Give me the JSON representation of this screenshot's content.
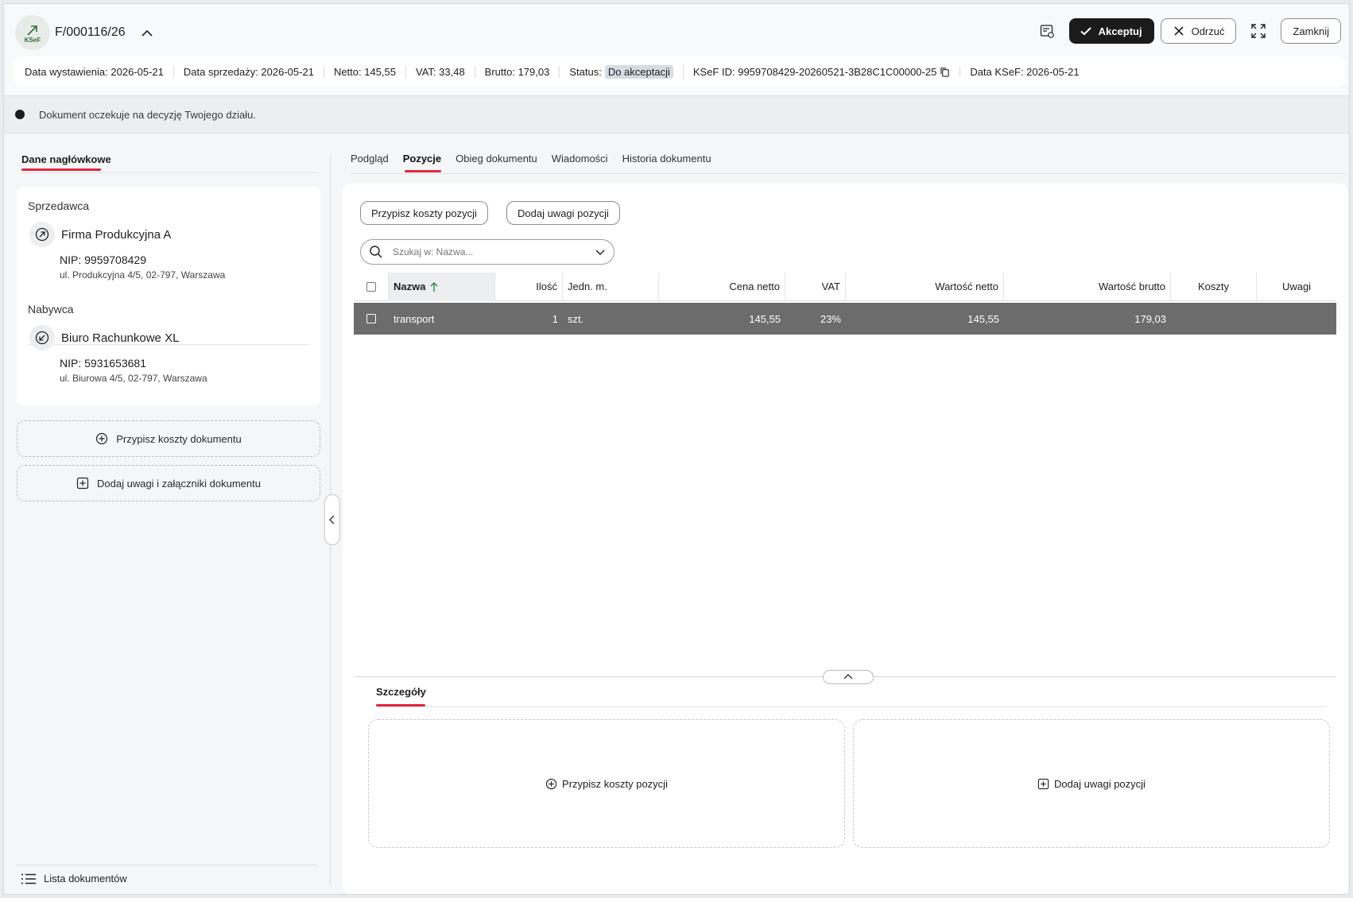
{
  "header": {
    "logo_text": "KSeF",
    "doc_number": "F/000116/26",
    "accept_label": "Akceptuj",
    "reject_label": "Odrzuć",
    "close_label": "Zamknij"
  },
  "info": {
    "issue_date": "Data wystawienia: 2026-05-21",
    "sale_date": "Data sprzedaży: 2026-05-21",
    "net": "Netto: 145,55",
    "vat": "VAT: 33,48",
    "gross": "Brutto: 179,03",
    "status_label": "Status:",
    "status_value": "Do akceptacji",
    "ksef_id": "KSeF ID: 9959708429-20260521-3B28C1C00000-25",
    "ksef_date": "Data KSeF: 2026-05-21"
  },
  "notice": "Dokument oczekuje na decyzję Twojego działu.",
  "left": {
    "tab": "Dane nagłówkowe",
    "seller": {
      "label": "Sprzedawca",
      "name": "Firma Produkcyjna A",
      "nip": "NIP: 9959708429",
      "address": "ul. Produkcyjna 4/5, 02-797, Warszawa"
    },
    "buyer": {
      "label": "Nabywca",
      "name": "Biuro Rachunkowe XL",
      "nip": "NIP: 5931653681",
      "address": "ul. Biurowa 4/5, 02-797, Warszawa"
    },
    "assign_costs": "Przypisz koszty dokumentu",
    "add_notes": "Dodaj uwagi i załączniki dokumentu",
    "doc_list": "Lista dokumentów"
  },
  "tabs": [
    "Podgląd",
    "Pozycje",
    "Obieg dokumentu",
    "Wiadomości",
    "Historia dokumentu"
  ],
  "toolbar": {
    "assign_costs": "Przypisz koszty pozycji",
    "add_notes": "Dodaj uwagi pozycji",
    "search_placeholder": "Szukaj w: Nazwa..."
  },
  "table": {
    "columns": [
      "Nazwa",
      "Ilość",
      "Jedn. m.",
      "Cena netto",
      "VAT",
      "Wartość netto",
      "Wartość brutto",
      "Koszty",
      "Uwagi"
    ],
    "rows": [
      {
        "name": "transport",
        "qty": "1",
        "unit": "szt.",
        "price": "145,55",
        "vat": "23%",
        "net": "145,55",
        "gross": "179,03",
        "costs": "",
        "notes": ""
      }
    ]
  },
  "details": {
    "tab": "Szczegóły",
    "assign_costs": "Przypisz koszty pozycji",
    "add_notes": "Dodaj uwagi pozycji"
  },
  "colors": {
    "accent": "#e2263b",
    "dark": "#1b1b1b",
    "selected_row": "#6c6c6c"
  }
}
